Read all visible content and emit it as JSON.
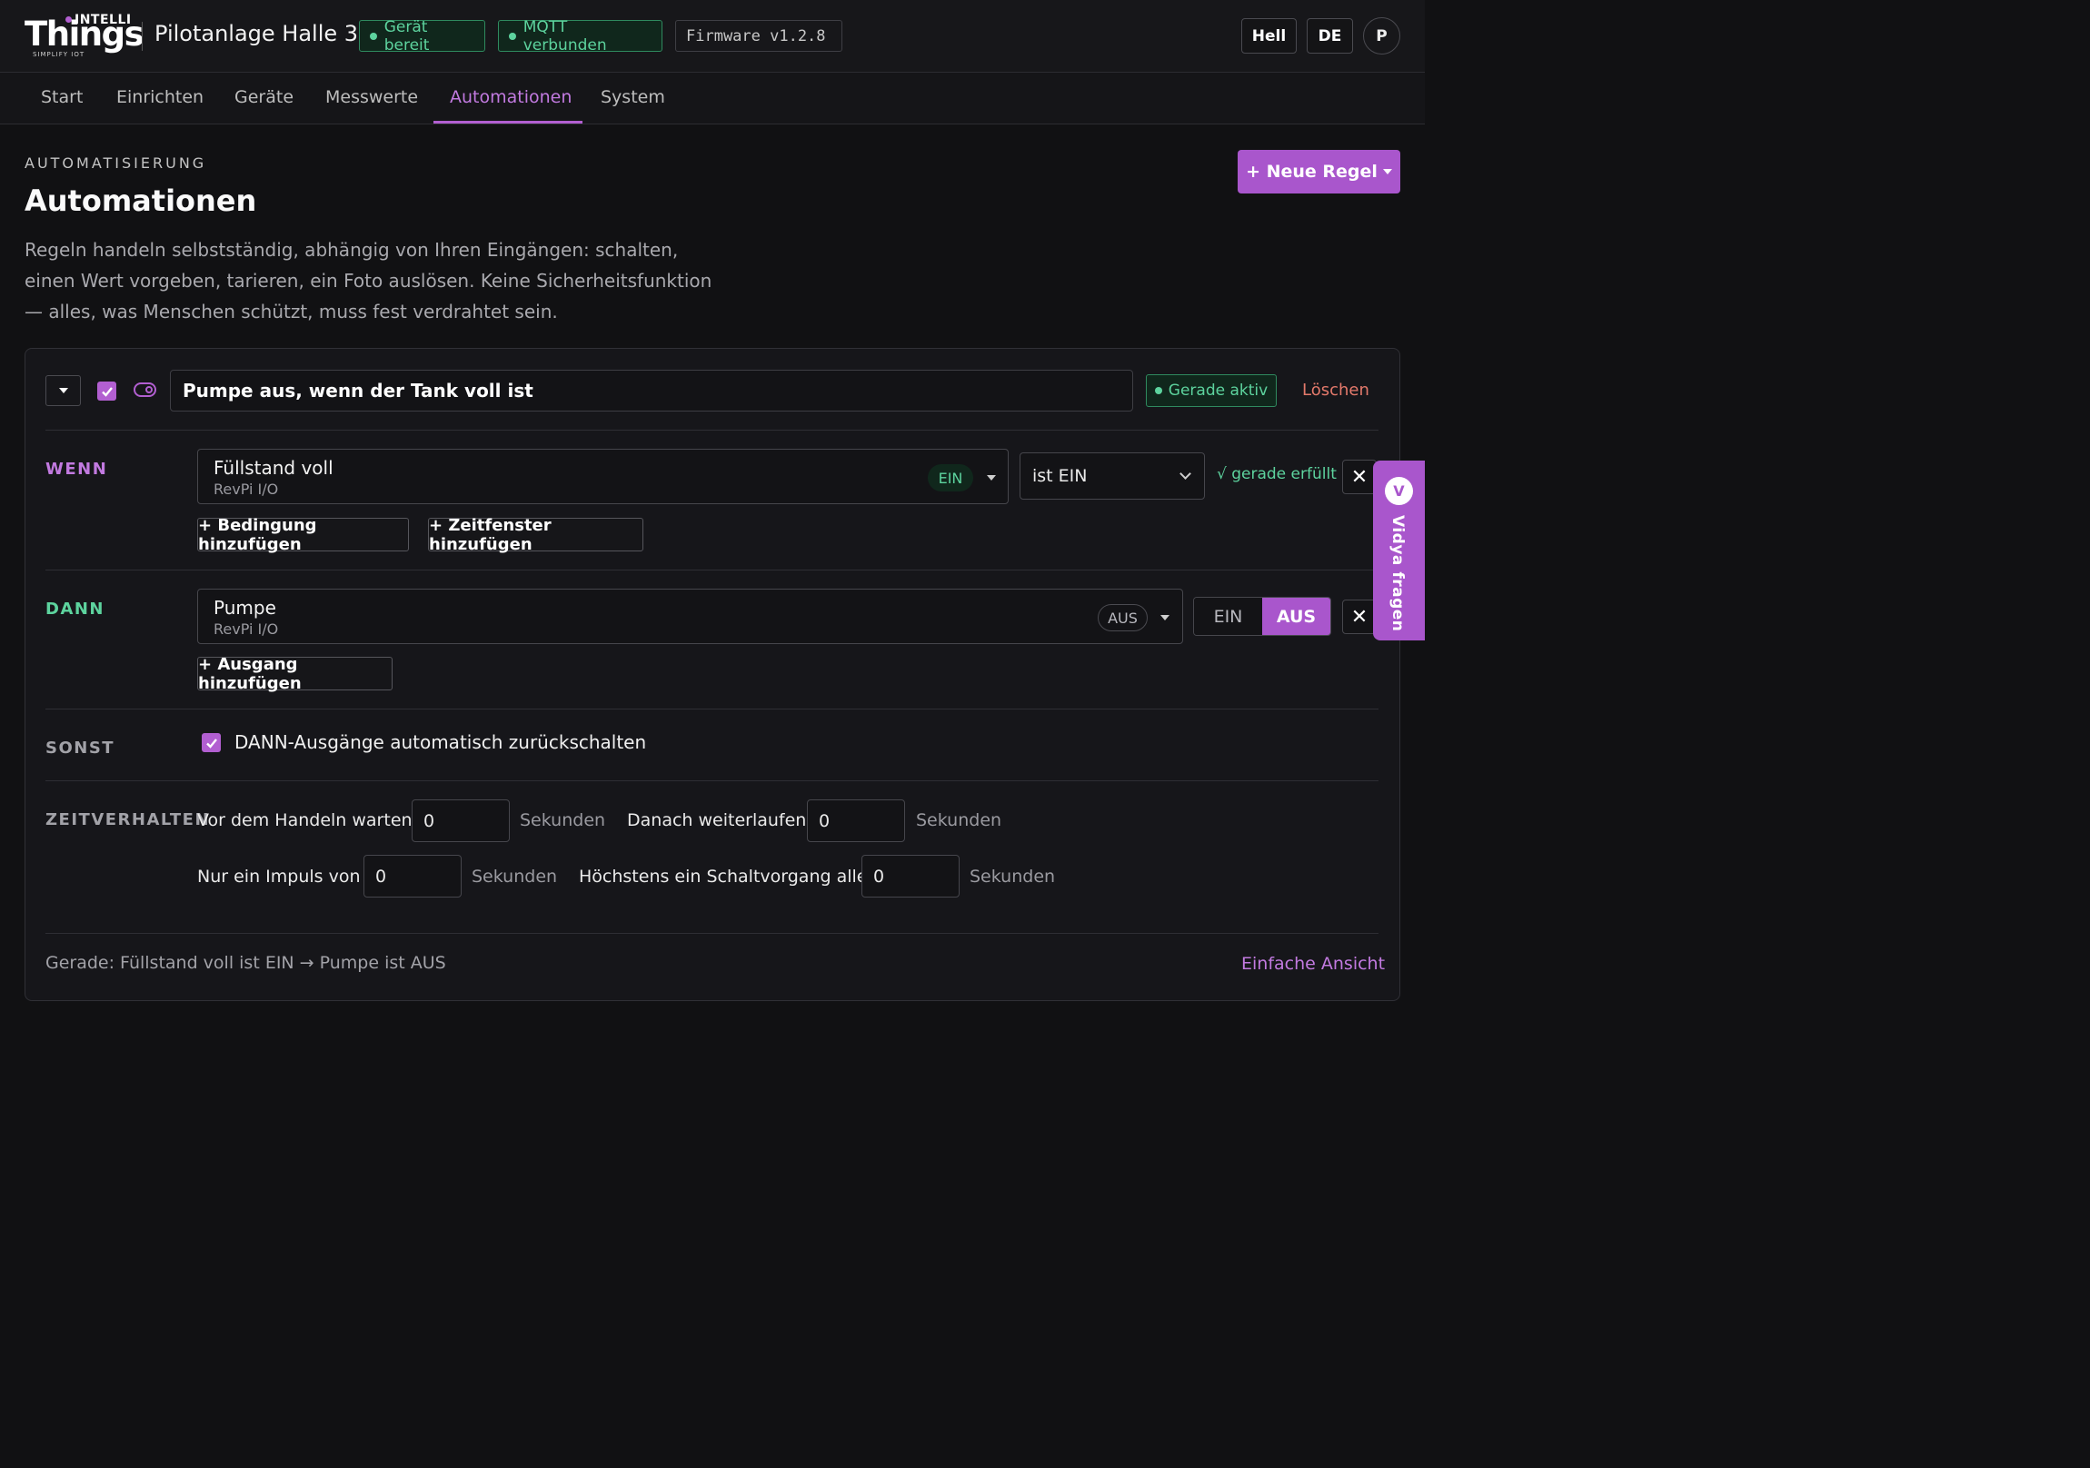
{
  "brand": {
    "intelli": "INTELLI",
    "things": "Things",
    "tagline": "SIMPLIFY IOT"
  },
  "header": {
    "site_title": "Pilotanlage Halle 3",
    "status_device": "Gerät bereit",
    "status_mqtt": "MQTT verbunden",
    "firmware": "Firmware v1.2.8",
    "theme_button": "Hell",
    "language_button": "DE",
    "avatar_initial": "P"
  },
  "nav": {
    "items": [
      "Start",
      "Einrichten",
      "Geräte",
      "Messwerte",
      "Automationen",
      "System"
    ],
    "active": "Automationen"
  },
  "page": {
    "eyebrow": "AUTOMATISIERUNG",
    "title": "Automationen",
    "intro": "Regeln handeln selbstständig, abhängig von Ihren Eingängen: schalten, einen Wert vorgeben, tarieren, ein Foto auslösen. Keine Sicherheitsfunktion — alles, was Menschen schützt, muss fest verdrahtet sein.",
    "new_rule_button": "+ Neue Regel"
  },
  "rule": {
    "name": "Pumpe aus, wenn der Tank voll ist",
    "enabled": true,
    "status": "Gerade aktiv",
    "delete": "Löschen",
    "when": {
      "label": "WENN",
      "input_name": "Füllstand voll",
      "input_source": "RevPi I/O",
      "input_state": "EIN",
      "operator": "ist EIN",
      "fulfilled": "√ gerade erfüllt",
      "add_condition": "+ Bedingung hinzufügen",
      "add_timewindow": "+ Zeitfenster hinzufügen"
    },
    "then": {
      "label": "DANN",
      "output_name": "Pumpe",
      "output_source": "RevPi I/O",
      "output_state": "AUS",
      "option_on": "EIN",
      "option_off": "AUS",
      "selected": "AUS",
      "add_output": "+ Ausgang hinzufügen"
    },
    "else": {
      "label": "SONST",
      "auto_reset_label": "DANN-Ausgänge automatisch zurückschalten",
      "auto_reset_checked": true
    },
    "timing": {
      "label": "ZEITVERHALTEN",
      "wait_label": "Vor dem Handeln warten",
      "wait_value": "0",
      "run_on_label": "Danach weiterlaufen",
      "run_on_value": "0",
      "pulse_label": "Nur ein Impuls von",
      "pulse_value": "0",
      "max_rate_label": "Höchstens ein Schaltvorgang alle",
      "max_rate_value": "0",
      "unit": "Sekunden"
    },
    "footer_status": "Gerade: Füllstand voll ist EIN → Pumpe ist AUS",
    "simple_view": "Einfache Ansicht"
  },
  "assistant": {
    "initial": "V",
    "label": "Vidya fragen"
  },
  "colors": {
    "accent": "#b25fd1",
    "success": "#5dd39e",
    "danger": "#e3796b",
    "background": "#111113"
  }
}
